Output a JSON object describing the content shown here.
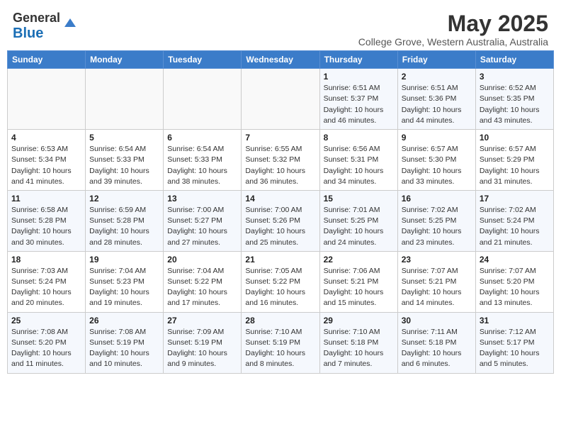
{
  "header": {
    "logo_general": "General",
    "logo_blue": "Blue",
    "title": "May 2025",
    "subtitle": "College Grove, Western Australia, Australia"
  },
  "days_of_week": [
    "Sunday",
    "Monday",
    "Tuesday",
    "Wednesday",
    "Thursday",
    "Friday",
    "Saturday"
  ],
  "weeks": [
    [
      {
        "day": "",
        "info": ""
      },
      {
        "day": "",
        "info": ""
      },
      {
        "day": "",
        "info": ""
      },
      {
        "day": "",
        "info": ""
      },
      {
        "day": "1",
        "info": "Sunrise: 6:51 AM\nSunset: 5:37 PM\nDaylight: 10 hours\nand 46 minutes."
      },
      {
        "day": "2",
        "info": "Sunrise: 6:51 AM\nSunset: 5:36 PM\nDaylight: 10 hours\nand 44 minutes."
      },
      {
        "day": "3",
        "info": "Sunrise: 6:52 AM\nSunset: 5:35 PM\nDaylight: 10 hours\nand 43 minutes."
      }
    ],
    [
      {
        "day": "4",
        "info": "Sunrise: 6:53 AM\nSunset: 5:34 PM\nDaylight: 10 hours\nand 41 minutes."
      },
      {
        "day": "5",
        "info": "Sunrise: 6:54 AM\nSunset: 5:33 PM\nDaylight: 10 hours\nand 39 minutes."
      },
      {
        "day": "6",
        "info": "Sunrise: 6:54 AM\nSunset: 5:33 PM\nDaylight: 10 hours\nand 38 minutes."
      },
      {
        "day": "7",
        "info": "Sunrise: 6:55 AM\nSunset: 5:32 PM\nDaylight: 10 hours\nand 36 minutes."
      },
      {
        "day": "8",
        "info": "Sunrise: 6:56 AM\nSunset: 5:31 PM\nDaylight: 10 hours\nand 34 minutes."
      },
      {
        "day": "9",
        "info": "Sunrise: 6:57 AM\nSunset: 5:30 PM\nDaylight: 10 hours\nand 33 minutes."
      },
      {
        "day": "10",
        "info": "Sunrise: 6:57 AM\nSunset: 5:29 PM\nDaylight: 10 hours\nand 31 minutes."
      }
    ],
    [
      {
        "day": "11",
        "info": "Sunrise: 6:58 AM\nSunset: 5:28 PM\nDaylight: 10 hours\nand 30 minutes."
      },
      {
        "day": "12",
        "info": "Sunrise: 6:59 AM\nSunset: 5:28 PM\nDaylight: 10 hours\nand 28 minutes."
      },
      {
        "day": "13",
        "info": "Sunrise: 7:00 AM\nSunset: 5:27 PM\nDaylight: 10 hours\nand 27 minutes."
      },
      {
        "day": "14",
        "info": "Sunrise: 7:00 AM\nSunset: 5:26 PM\nDaylight: 10 hours\nand 25 minutes."
      },
      {
        "day": "15",
        "info": "Sunrise: 7:01 AM\nSunset: 5:25 PM\nDaylight: 10 hours\nand 24 minutes."
      },
      {
        "day": "16",
        "info": "Sunrise: 7:02 AM\nSunset: 5:25 PM\nDaylight: 10 hours\nand 23 minutes."
      },
      {
        "day": "17",
        "info": "Sunrise: 7:02 AM\nSunset: 5:24 PM\nDaylight: 10 hours\nand 21 minutes."
      }
    ],
    [
      {
        "day": "18",
        "info": "Sunrise: 7:03 AM\nSunset: 5:24 PM\nDaylight: 10 hours\nand 20 minutes."
      },
      {
        "day": "19",
        "info": "Sunrise: 7:04 AM\nSunset: 5:23 PM\nDaylight: 10 hours\nand 19 minutes."
      },
      {
        "day": "20",
        "info": "Sunrise: 7:04 AM\nSunset: 5:22 PM\nDaylight: 10 hours\nand 17 minutes."
      },
      {
        "day": "21",
        "info": "Sunrise: 7:05 AM\nSunset: 5:22 PM\nDaylight: 10 hours\nand 16 minutes."
      },
      {
        "day": "22",
        "info": "Sunrise: 7:06 AM\nSunset: 5:21 PM\nDaylight: 10 hours\nand 15 minutes."
      },
      {
        "day": "23",
        "info": "Sunrise: 7:07 AM\nSunset: 5:21 PM\nDaylight: 10 hours\nand 14 minutes."
      },
      {
        "day": "24",
        "info": "Sunrise: 7:07 AM\nSunset: 5:20 PM\nDaylight: 10 hours\nand 13 minutes."
      }
    ],
    [
      {
        "day": "25",
        "info": "Sunrise: 7:08 AM\nSunset: 5:20 PM\nDaylight: 10 hours\nand 11 minutes."
      },
      {
        "day": "26",
        "info": "Sunrise: 7:08 AM\nSunset: 5:19 PM\nDaylight: 10 hours\nand 10 minutes."
      },
      {
        "day": "27",
        "info": "Sunrise: 7:09 AM\nSunset: 5:19 PM\nDaylight: 10 hours\nand 9 minutes."
      },
      {
        "day": "28",
        "info": "Sunrise: 7:10 AM\nSunset: 5:19 PM\nDaylight: 10 hours\nand 8 minutes."
      },
      {
        "day": "29",
        "info": "Sunrise: 7:10 AM\nSunset: 5:18 PM\nDaylight: 10 hours\nand 7 minutes."
      },
      {
        "day": "30",
        "info": "Sunrise: 7:11 AM\nSunset: 5:18 PM\nDaylight: 10 hours\nand 6 minutes."
      },
      {
        "day": "31",
        "info": "Sunrise: 7:12 AM\nSunset: 5:17 PM\nDaylight: 10 hours\nand 5 minutes."
      }
    ]
  ]
}
